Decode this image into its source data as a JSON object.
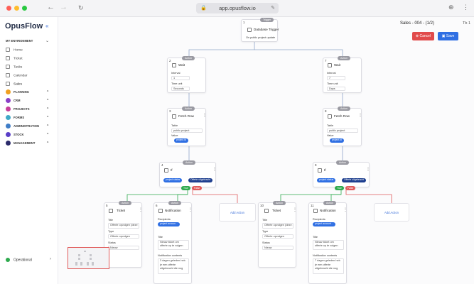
{
  "browser": {
    "url": "app.opusflow.io",
    "back_icon": "arrow-left-icon",
    "forward_icon": "arrow-right-icon"
  },
  "sidebar": {
    "logo": "OpusFlow",
    "environment": "MY ENVIRONMENT",
    "items": [
      {
        "label": "Home"
      },
      {
        "label": "Ticket"
      },
      {
        "label": "Tasks"
      },
      {
        "label": "Calendar"
      },
      {
        "label": "Sales"
      }
    ],
    "groups": [
      {
        "label": "PLANNING",
        "color": "#f0a020"
      },
      {
        "label": "CRM",
        "color": "#8a3fc7"
      },
      {
        "label": "PROJECTS",
        "color": "#c73f9a"
      },
      {
        "label": "FORMS",
        "color": "#3fa9c7"
      },
      {
        "label": "ADMINISTRATION",
        "color": "#3f7dc7"
      },
      {
        "label": "STOCK",
        "color": "#5a3fc7"
      },
      {
        "label": "MANAGEMENT",
        "color": "#2a2a6a"
      }
    ],
    "status": "Operational"
  },
  "header": {
    "title": "Sales - 004 - (1/2)",
    "tab": "Tb 1",
    "cancel_label": "Cancel",
    "save_label": "Save"
  },
  "workflow": {
    "trigger": {
      "num": "1",
      "pill": "Trigger",
      "title": "Database Trigger",
      "subtitle": "On public project update"
    },
    "wait_left": {
      "num": "2",
      "pill": "Action",
      "title": "Wait",
      "interval_label": "Interval",
      "interval": "1",
      "timeunit_label": "Time unit",
      "timeunit": "Seconds"
    },
    "wait_right": {
      "num": "7",
      "pill": "Action",
      "title": "Wait",
      "interval_label": "Interval",
      "interval": "7",
      "timeunit_label": "Time unit",
      "timeunit": "Days"
    },
    "fetch_left": {
      "num": "3",
      "pill": "Action",
      "title": "Fetch Row",
      "table_label": "Table",
      "table": "public.project",
      "value_label": "Value",
      "value_chip": "project.id"
    },
    "fetch_right": {
      "num": "8",
      "pill": "Action",
      "title": "Fetch Row",
      "table_label": "Table",
      "table": "public.project",
      "value_label": "Value",
      "value_chip": "project.id"
    },
    "if_left": {
      "num": "4",
      "pill": "Action",
      "title": "If",
      "chip1": "project.status",
      "chip2": "Offerte uitgebracht",
      "true_label": "True",
      "false_label": "False"
    },
    "if_right": {
      "num": "9",
      "pill": "Action",
      "title": "If",
      "chip1": "project.status",
      "chip2": "Offerte uitgebracht",
      "true_label": "True",
      "false_label": "False"
    },
    "ticket_left": {
      "num": "5",
      "pill": "Action",
      "title": "Ticket",
      "title_label": "Title",
      "title_val": "Offerte opvolgen (deze 3)",
      "type_label": "Type",
      "type_val": "Offerte opvolgen",
      "status_label": "Status",
      "status_val": "Nieuw"
    },
    "ticket_right": {
      "num": "10",
      "pill": "Action",
      "title": "Ticket",
      "title_label": "Title",
      "title_val": "Offerte opvolgen (deze 3)",
      "type_label": "Type",
      "type_val": "Offerte opvolgen",
      "status_label": "Status",
      "status_val": "Nieuw"
    },
    "notif_left": {
      "num": "6",
      "pill": "Action",
      "title": "Notification",
      "recipients_label": "Recipients",
      "recipient_chip": "project.accoun...",
      "title_label": "Title",
      "title_val": "Nieuw ticket om offerte op te volgen",
      "contents_label": "Notification contents",
      "contents_val": "3 dagen geleden heb je een offerte uitgebracht die nog"
    },
    "notif_right": {
      "num": "11",
      "pill": "Action",
      "title": "Notification",
      "recipients_label": "Recipients",
      "recipient_chip": "project.account...",
      "title_label": "Title",
      "title_val": "Nieuw ticket om offerte op te volgen",
      "contents_label": "Notification contents",
      "contents_val": "7 dagen geleden heb je een offerte uitgebracht die nog"
    },
    "add_action_left": "Add Action",
    "add_action_right": "Add Action"
  }
}
